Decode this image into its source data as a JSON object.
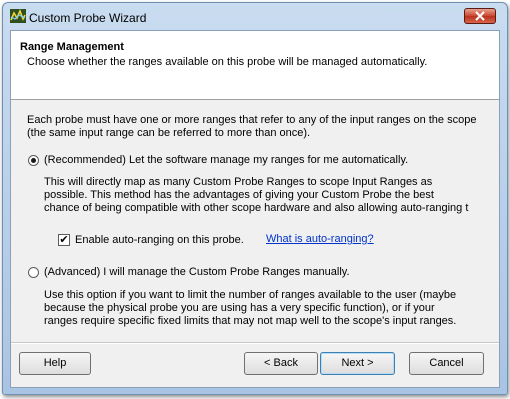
{
  "window": {
    "title": "Custom Probe Wizard"
  },
  "header": {
    "title": "Range Management",
    "subtitle": "Choose whether the ranges available on this probe will be managed automatically."
  },
  "intro": "Each probe must have one or more ranges that refer to any of the input ranges on the scope (the same input range can be referred to more than once).",
  "option_auto": {
    "label": "(Recommended) Let the software manage my ranges for me automatically.",
    "selected": true,
    "description_lines": [
      "This will directly map as many Custom Probe Ranges to scope Input Ranges as",
      "possible. This method has the advantages of giving your Custom Probe the best",
      "chance of being compatible with other scope hardware and also allowing auto-ranging t"
    ],
    "checkbox_label": "Enable auto-ranging on this probe.",
    "checkbox_checked": true,
    "link": "What is auto-ranging?"
  },
  "option_manual": {
    "label": "(Advanced) I will manage the Custom Probe Ranges manually.",
    "selected": false,
    "description_lines": [
      "Use this option if you want to limit the number of ranges available to the user (maybe",
      "because the physical probe you are using has a very specific function), or if your",
      "ranges require specific fixed limits that may not map well to the scope's input ranges."
    ]
  },
  "buttons": {
    "help": "Help",
    "back": "< Back",
    "next": "Next >",
    "cancel": "Cancel"
  },
  "icons": {
    "app": "probe-wizard-icon",
    "close": "close-icon",
    "checkmark": "✔"
  }
}
